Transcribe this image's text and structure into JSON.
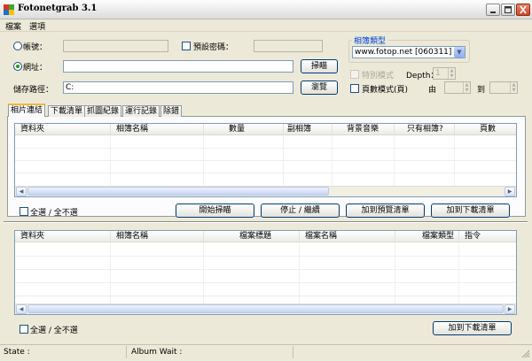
{
  "window": {
    "title": "Fotonetgrab 3.1"
  },
  "menu": [
    "檔案",
    "選項"
  ],
  "form": {
    "account_label": "帳號：",
    "account_value": "",
    "default_password_label": "預設密碼：",
    "password_value": "",
    "url_label": "網址：",
    "url_value": "",
    "scan_button": "掃瞄",
    "save_path_label": "儲存路徑：",
    "save_path_value": "C:",
    "browse_button": "瀏覽"
  },
  "album_type": {
    "legend": "相簿類型",
    "selected": "www.fotop.net [060311]"
  },
  "options": {
    "special_mode": "特別模式",
    "depth_label": "Depth：",
    "depth_value": "1",
    "page_mode": "頁數模式(頁)",
    "from_label": "由",
    "to_label": "到"
  },
  "tabs": [
    "相片連結",
    "下載清單",
    "抓圖紀錄",
    "運行記錄",
    "除錯"
  ],
  "upper_list": {
    "columns": [
      "資料夾",
      "相簿名稱",
      "數量",
      "副相簿",
      "背景音樂",
      "只有相簿?",
      "頁數"
    ]
  },
  "upper_actions": {
    "select_all": "全選 / 全不選",
    "start_scan": "開始掃瞄",
    "stop_continue": "停止 / 繼續",
    "add_preview": "加到預覽清單",
    "add_download": "加到下載清單"
  },
  "lower_list": {
    "columns": [
      "資料夾",
      "相簿名稱",
      "檔案標題",
      "檔案名稱",
      "檔案類型",
      "指令"
    ]
  },
  "lower_actions": {
    "select_all": "全選 / 全不選",
    "add_download": "加到下載清單"
  },
  "status": {
    "state": "State :",
    "album_wait": "Album Wait :"
  },
  "icons": {
    "minimize": "minimize-icon",
    "maximize": "maximize-icon",
    "close": "close-icon",
    "dropdown": "chevron-down-icon",
    "scroll_left": "chevron-left-icon",
    "scroll_right": "chevron-right-icon"
  },
  "colors": {
    "legend": "#0046d5",
    "close_button": "#c8482a",
    "tab_highlight": "#f3b835"
  }
}
